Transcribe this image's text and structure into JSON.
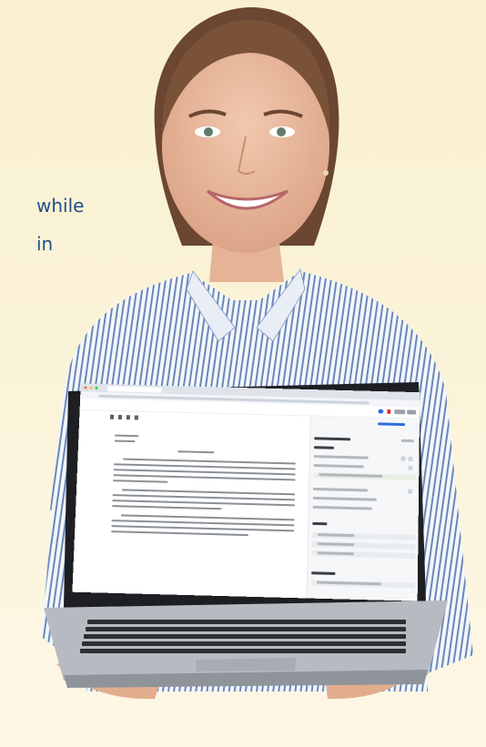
{
  "copy_fragments": [
    "while",
    "in"
  ],
  "colors": {
    "background": "#faf2d6",
    "copy": "#1f4f8a",
    "accent": "#2d6cdf"
  }
}
